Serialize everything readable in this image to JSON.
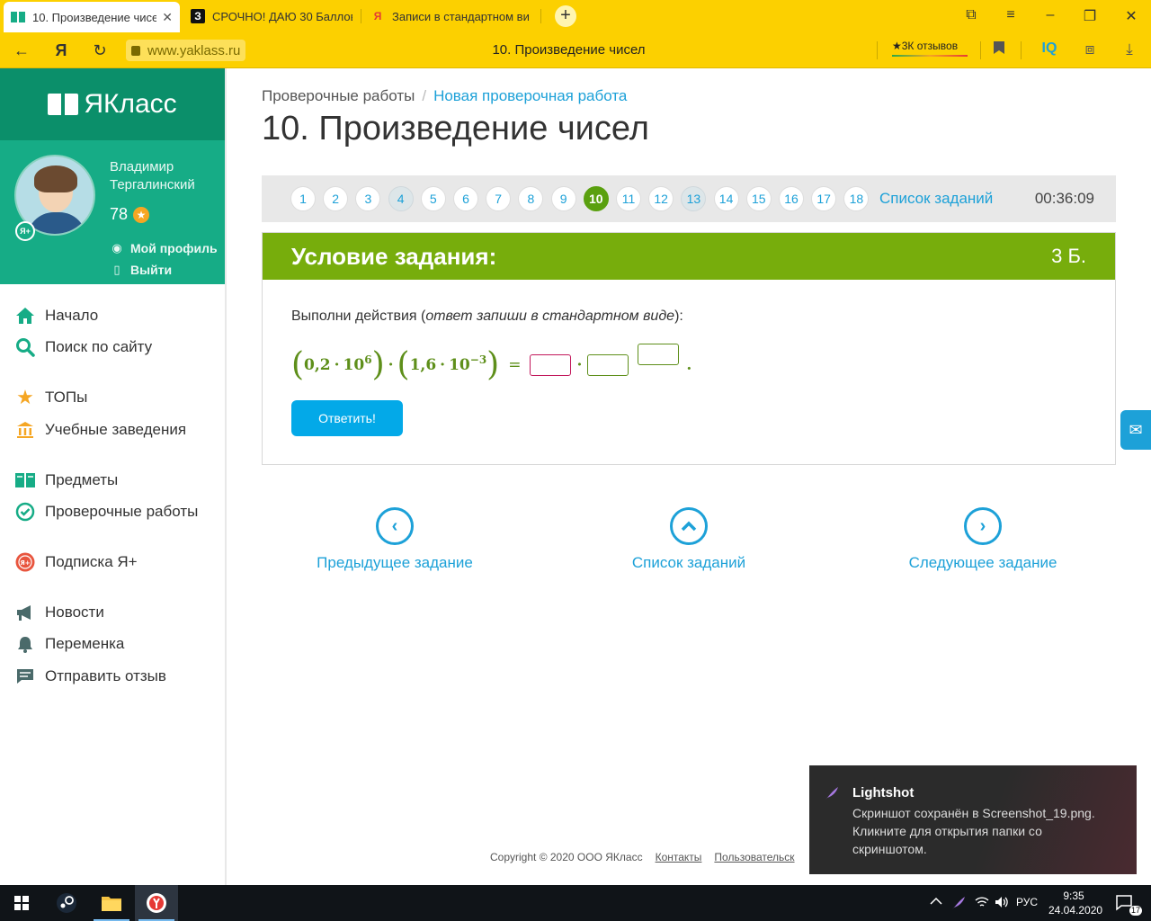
{
  "browser": {
    "tabs": [
      {
        "title": "10. Произведение чисе",
        "favicon": "yaklass-icon"
      },
      {
        "title": "СРОЧНО! ДАЮ 30 Баллов",
        "favicon": "znanija-icon",
        "favicon_text": "З"
      },
      {
        "title": "Записи в стандартном ви",
        "favicon": "yandex-icon",
        "favicon_text": "Я"
      }
    ],
    "new_tab": "+",
    "address": "www.yaklass.ru",
    "page_title": "10. Произведение чисел",
    "reviews": "★3К отзывов",
    "iq": "IQ",
    "nav_glyphs": {
      "back": "←",
      "yandex": "Я",
      "reload": "↻"
    }
  },
  "sidebar": {
    "brand": "ЯКласс",
    "user": {
      "name": "Владимир Тергалинский",
      "score": "78",
      "badge": "Я+"
    },
    "profile_links": [
      {
        "label": "Мой профиль",
        "icon": "user-circle-icon"
      },
      {
        "label": "Выйти",
        "icon": "logout-icon"
      }
    ],
    "menu": [
      {
        "label": "Начало",
        "icon": "home-icon"
      },
      {
        "label": "Поиск по сайту",
        "icon": "search-icon"
      },
      {
        "label": "ТОПы",
        "icon": "star-icon"
      },
      {
        "label": "Учебные заведения",
        "icon": "institution-icon"
      },
      {
        "label": "Предметы",
        "icon": "book-icon"
      },
      {
        "label": "Проверочные работы",
        "icon": "check-circle-icon"
      },
      {
        "label": "Подписка Я+",
        "icon": "subscription-icon"
      },
      {
        "label": "Новости",
        "icon": "megaphone-icon"
      },
      {
        "label": "Переменка",
        "icon": "bell-icon"
      },
      {
        "label": "Отправить отзыв",
        "icon": "feedback-icon"
      }
    ]
  },
  "main": {
    "breadcrumb": {
      "root": "Проверочные работы",
      "sep": "/",
      "current": "Новая проверочная работа"
    },
    "title": "10. Произведение чисел",
    "pager": {
      "items": [
        "1",
        "2",
        "3",
        "4",
        "5",
        "6",
        "7",
        "8",
        "9",
        "10",
        "11",
        "12",
        "13",
        "14",
        "15",
        "16",
        "17",
        "18"
      ],
      "done": [
        "4",
        "13"
      ],
      "current": "10",
      "list_label": "Список заданий",
      "timer": "00:36:09"
    },
    "task": {
      "header": "Условие задания:",
      "points": "3 Б.",
      "instruction_pre": "Выполни действия (",
      "instruction_em": "ответ запиши в стандартном виде",
      "instruction_post": "):",
      "formula": {
        "a": "0,2",
        "dot": "·",
        "base": "10",
        "exp1": "6",
        "b": "1,6",
        "exp2": "−3",
        "eq": "=",
        "end": "."
      },
      "submit": "Ответить!"
    },
    "nav": {
      "prev": "Предыдущее задание",
      "list": "Список заданий",
      "next": "Следующее задание"
    },
    "footer": {
      "copyright": "Copyright © 2020 ООО ЯКласс",
      "contacts": "Контакты",
      "agreement": "Пользовательск"
    }
  },
  "toast": {
    "title": "Lightshot",
    "body": "Скриншот сохранён в Screenshot_19.png. Кликните для открытия папки со скриншотом."
  },
  "taskbar": {
    "lang": "РУС",
    "time": "9:35",
    "date": "24.04.2020",
    "notifications": "17"
  },
  "colors": {
    "brand_green": "#0b8f6a",
    "profile_green": "#16ac86",
    "task_header": "#77ad0c",
    "link_blue": "#1da1d8",
    "button_blue": "#03a9e8",
    "browser_yellow": "#fcd000"
  }
}
